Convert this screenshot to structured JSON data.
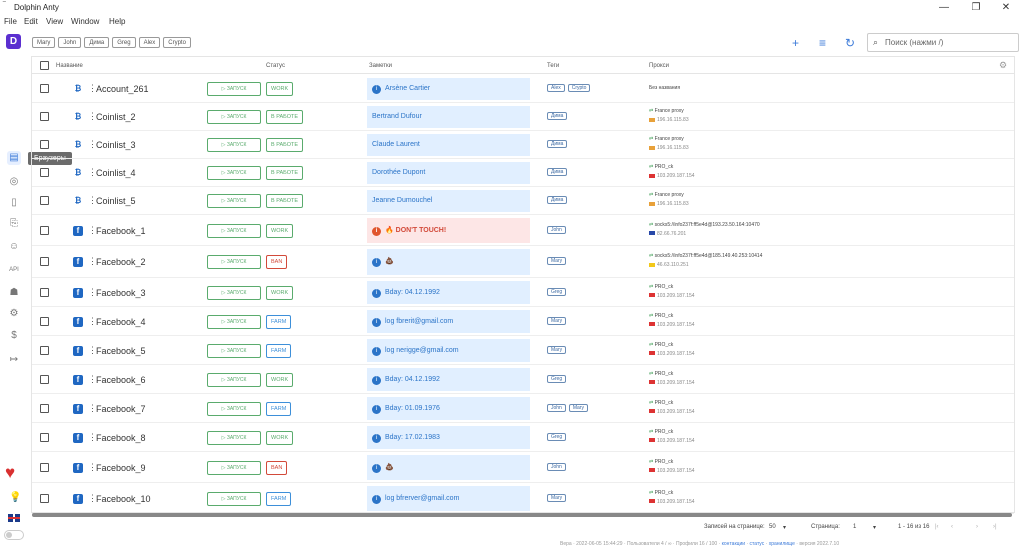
{
  "window": {
    "app_icon": "‾",
    "title": "Dolphin Anty",
    "min": "—",
    "max": "❐",
    "close": "✕"
  },
  "menu": [
    "File",
    "Edit",
    "View",
    "Window",
    "Help"
  ],
  "sidebar": {
    "logo": "D",
    "tooltip": "Браузеры",
    "icons": [
      "browser-icon",
      "chat-icon",
      "bookmark-icon",
      "copy-icon",
      "users-icon",
      "api-icon",
      "bot-icon",
      "settings-icon",
      "dollar-icon",
      "logout-icon"
    ],
    "icon_glyphs": [
      "▤",
      "◎",
      "▯",
      "⎘",
      "☺",
      "API",
      "☗",
      "⚙",
      "$",
      "↦"
    ]
  },
  "filter_tags": [
    "Mary",
    "John",
    "Дима",
    "Greg",
    "Alex",
    "Crypto"
  ],
  "toolbar": {
    "add": "+",
    "filter": "≡",
    "refresh": "↻"
  },
  "search": {
    "placeholder": "Поиск (нажми /)"
  },
  "columns": {
    "name": "Название",
    "status": "Статус",
    "notes": "Заметки",
    "tags": "Теги",
    "proxy": "Прокси"
  },
  "rows": [
    {
      "kind": "btc",
      "name": "Account_261",
      "run": "▷ ЗАПУСК",
      "status": "WORK",
      "status_color": "#5aab6d",
      "note": "Arsène Cartier",
      "note_icon": true,
      "tags": [
        "Alex",
        "Crypto"
      ],
      "proxy_plain": "Без названия"
    },
    {
      "kind": "btc",
      "name": "Coinlist_2",
      "run": "▷ ЗАПУСК",
      "status": "В РАБОТЕ",
      "status_color": "#5aab6d",
      "note": "Bertrand Dufour",
      "tags": [
        "Дима"
      ],
      "proxy_line1": "France proxy",
      "proxy_line2": "196.16.115.83"
    },
    {
      "kind": "btc",
      "name": "Coinlist_3",
      "run": "▷ ЗАПУСК",
      "status": "В РАБОТЕ",
      "status_color": "#5aab6d",
      "note": "Claude Laurent",
      "tags": [
        "Дима"
      ],
      "proxy_line1": "France proxy",
      "proxy_line2": "196.16.115.83"
    },
    {
      "kind": "btc",
      "name": "Coinlist_4",
      "run": "▷ ЗАПУСК",
      "status": "В РАБОТЕ",
      "status_color": "#5aab6d",
      "note": "Dorothée Dupont",
      "tags": [
        "Дима"
      ],
      "proxy_line1": "PRO_ck",
      "proxy_line2": "103.209.187.154"
    },
    {
      "kind": "btc",
      "name": "Coinlist_5",
      "run": "▷ ЗАПУСК",
      "status": "В РАБОТЕ",
      "status_color": "#5aab6d",
      "note": "Jeanne Dumouchel",
      "tags": [
        "Дима"
      ],
      "proxy_line1": "France proxy",
      "proxy_line2": "196.16.115.83"
    },
    {
      "kind": "fb",
      "name": "Facebook_1",
      "run": "▷ ЗАПУСК",
      "status": "WORK",
      "status_color": "#5aab6d",
      "note": "🔥 DON'T TOUCH!",
      "note_icon": true,
      "note_red": true,
      "tags": [
        "John"
      ],
      "proxy_line1": "socks5://info237f:ff5e4d@193.23.50.164:10470",
      "proxy_line2": "82.66.76.201"
    },
    {
      "kind": "fb",
      "name": "Facebook_2",
      "run": "▷ ЗАПУСК",
      "status": "BAN",
      "status_color": "#d24a3a",
      "note": "💩",
      "note_icon": true,
      "tags": [
        "Mary"
      ],
      "proxy_line1": "socks5://info237f:ff5e4d@185.149.40.253:10414",
      "proxy_line2": "46.63.110.251"
    },
    {
      "kind": "fb",
      "name": "Facebook_3",
      "run": "▷ ЗАПУСК",
      "status": "WORK",
      "status_color": "#5aab6d",
      "note": "Bday: 04.12.1992",
      "note_icon": true,
      "tags": [
        "Greg"
      ],
      "proxy_line1": "PRO_ck",
      "proxy_line2": "103.209.187.154"
    },
    {
      "kind": "fb",
      "name": "Facebook_4",
      "run": "▷ ЗАПУСК",
      "status": "FARM",
      "status_color": "#3d8fd9",
      "note": "log fbrerit@gmail.com",
      "note_icon": true,
      "tags": [
        "Mary"
      ],
      "proxy_line1": "PRO_ck",
      "proxy_line2": "103.209.187.154"
    },
    {
      "kind": "fb",
      "name": "Facebook_5",
      "run": "▷ ЗАПУСК",
      "status": "FARM",
      "status_color": "#3d8fd9",
      "note": "log nerigge@gmail.com",
      "note_icon": true,
      "tags": [
        "Mary"
      ],
      "proxy_line1": "PRO_ck",
      "proxy_line2": "103.209.187.154"
    },
    {
      "kind": "fb",
      "name": "Facebook_6",
      "run": "▷ ЗАПУСК",
      "status": "WORK",
      "status_color": "#5aab6d",
      "note": "Bday: 04.12.1992",
      "note_icon": true,
      "tags": [
        "Greg"
      ],
      "proxy_line1": "PRO_ck",
      "proxy_line2": "103.209.187.154"
    },
    {
      "kind": "fb",
      "name": "Facebook_7",
      "run": "▷ ЗАПУСК",
      "status": "FARM",
      "status_color": "#3d8fd9",
      "note": "Bday: 01.09.1976",
      "note_icon": true,
      "tags": [
        "John",
        "Mary"
      ],
      "proxy_line1": "PRO_ck",
      "proxy_line2": "103.209.187.154"
    },
    {
      "kind": "fb",
      "name": "Facebook_8",
      "run": "▷ ЗАПУСК",
      "status": "WORK",
      "status_color": "#5aab6d",
      "note": "Bday: 17.02.1983",
      "note_icon": true,
      "tags": [
        "Greg"
      ],
      "proxy_line1": "PRO_ck",
      "proxy_line2": "103.209.187.154"
    },
    {
      "kind": "fb",
      "name": "Facebook_9",
      "run": "▷ ЗАПУСК",
      "status": "BAN",
      "status_color": "#d24a3a",
      "note": "💩",
      "note_icon": true,
      "tags": [
        "John"
      ],
      "proxy_line1": "PRO_ck",
      "proxy_line2": "103.209.187.154"
    },
    {
      "kind": "fb",
      "name": "Facebook_10",
      "run": "▷ ЗАПУСК",
      "status": "FARM",
      "status_color": "#3d8fd9",
      "note": "log bfrerver@gmail.com",
      "note_icon": true,
      "tags": [
        "Mary"
      ],
      "proxy_line1": "PRO_ck",
      "proxy_line2": "103.209.187.154"
    }
  ],
  "footer": {
    "per_page_label": "Записей на странице:",
    "per_page": "50",
    "page_label": "Страница:",
    "page": "1",
    "range": "1 - 16 из 16"
  },
  "status_bar": {
    "text": "Вера · 2022-06-05 15:44:29 · Пользователи 4 / ∞ · Профили 16 / 100 ·",
    "link1": "контакции",
    "link2": "статус",
    "link3": "хранилище",
    "version": "версия 2022.7.10"
  }
}
